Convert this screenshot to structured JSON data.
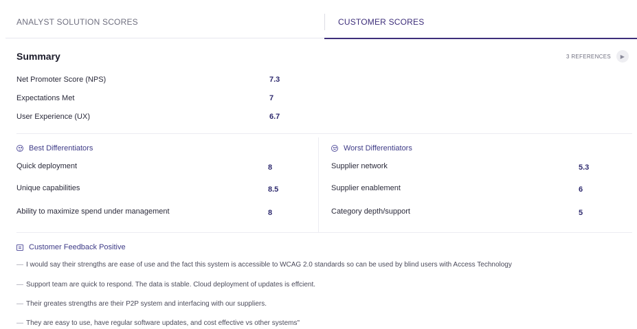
{
  "tabs": {
    "analyst": "ANALYST SOLUTION SCORES",
    "customer": "CUSTOMER SCORES"
  },
  "summary": {
    "title": "Summary",
    "references": "3 REFERENCES",
    "metrics": [
      {
        "label": "Net Promoter Score (NPS)",
        "value": "7.3"
      },
      {
        "label": "Expectations Met",
        "value": "7"
      },
      {
        "label": "User Experience (UX)",
        "value": "6.7"
      }
    ]
  },
  "best": {
    "title": "Best Differentiators",
    "items": [
      {
        "label": "Quick deployment",
        "value": "8"
      },
      {
        "label": "Unique capabilities",
        "value": "8.5"
      },
      {
        "label": "Ability to maximize spend under management",
        "value": "8"
      }
    ]
  },
  "worst": {
    "title": "Worst Differentiators",
    "items": [
      {
        "label": "Supplier network",
        "value": "5.3"
      },
      {
        "label": "Supplier enablement",
        "value": "6"
      },
      {
        "label": "Category depth/support",
        "value": "5"
      }
    ]
  },
  "feedback": {
    "title": "Customer Feedback Positive",
    "dash": "—",
    "items": [
      "I would say their strengths are ease of use and the fact this system is accessible to WCAG 2.0 standards so can be used by blind users with Access Technology",
      "Support team are quick to respond. The data is stable. Cloud deployment of updates is effcient.",
      "Their greates strengths are their P2P system and interfacing with our suppliers.",
      "They are easy to use, have regular software updates, and cost effective vs other systems\""
    ]
  },
  "colors": {
    "accent": "#3d2e7a",
    "value": "#2e2a6e",
    "divider": "#ececf2"
  }
}
